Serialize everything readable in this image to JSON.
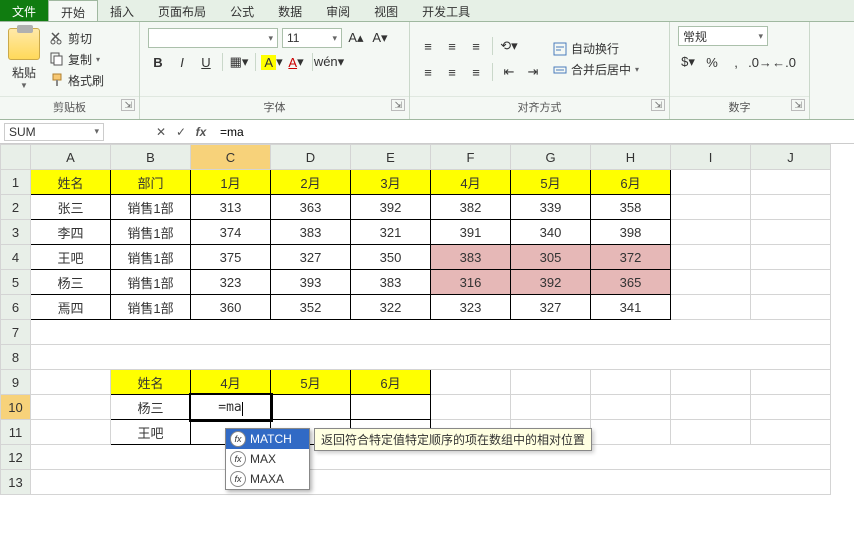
{
  "tabs": {
    "file": "文件",
    "home": "开始",
    "insert": "插入",
    "layout": "页面布局",
    "formulas": "公式",
    "data": "数据",
    "review": "审阅",
    "view": "视图",
    "dev": "开发工具"
  },
  "clipboard": {
    "paste": "粘贴",
    "cut": "剪切",
    "copy": "复制",
    "format_painter": "格式刷",
    "group_label": "剪贴板"
  },
  "font": {
    "family": "",
    "size": "11",
    "group_label": "字体",
    "bold": "B",
    "italic": "I",
    "underline": "U"
  },
  "alignment": {
    "wrap": "自动换行",
    "merge": "合并后居中",
    "group_label": "对齐方式"
  },
  "number": {
    "format": "常规",
    "group_label": "数字"
  },
  "formula_bar": {
    "name_box": "SUM",
    "formula": "=ma"
  },
  "columns": [
    "A",
    "B",
    "C",
    "D",
    "E",
    "F",
    "G",
    "H",
    "I",
    "J"
  ],
  "table1": {
    "headers": [
      "姓名",
      "部门",
      "1月",
      "2月",
      "3月",
      "4月",
      "5月",
      "6月"
    ],
    "rows": [
      [
        "张三",
        "销售1部",
        "313",
        "363",
        "392",
        "382",
        "339",
        "358"
      ],
      [
        "李四",
        "销售1部",
        "374",
        "383",
        "321",
        "391",
        "340",
        "398"
      ],
      [
        "王吧",
        "销售1部",
        "375",
        "327",
        "350",
        "383",
        "305",
        "372"
      ],
      [
        "杨三",
        "销售1部",
        "323",
        "393",
        "383",
        "316",
        "392",
        "365"
      ],
      [
        "焉四",
        "销售1部",
        "360",
        "352",
        "322",
        "323",
        "327",
        "341"
      ]
    ],
    "pink_cells": [
      [
        2,
        5
      ],
      [
        2,
        6
      ],
      [
        2,
        7
      ],
      [
        3,
        5
      ],
      [
        3,
        6
      ],
      [
        3,
        7
      ]
    ]
  },
  "table2": {
    "headers": [
      "姓名",
      "4月",
      "5月",
      "6月"
    ],
    "rows": [
      [
        "杨三",
        "=ma",
        "",
        ""
      ],
      [
        "王吧",
        "",
        "",
        ""
      ]
    ]
  },
  "autocomplete": {
    "items": [
      "MATCH",
      "MAX",
      "MAXA"
    ],
    "selected": 0,
    "tip": "返回符合特定值特定顺序的项在数组中的相对位置"
  },
  "active_cell": {
    "row": 10,
    "col": "C"
  }
}
